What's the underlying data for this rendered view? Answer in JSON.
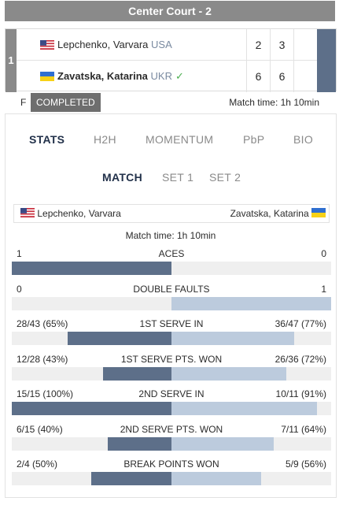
{
  "court_title": "Center Court - 2",
  "match": {
    "round": "1",
    "players": [
      {
        "name": "Lepchenko, Varvara",
        "country": "USA",
        "flag_icon": "us-flag-icon",
        "winner": false,
        "sets": [
          "2",
          "3",
          ""
        ]
      },
      {
        "name": "Zavatska, Katarina",
        "country": "UKR",
        "flag_icon": "ukraine-flag-icon",
        "winner": true,
        "winner_icon": "checkmark-icon",
        "sets": [
          "6",
          "6",
          ""
        ]
      }
    ],
    "status_prefix": "F",
    "status": "COMPLETED",
    "match_time": "Match time: 1h 10min"
  },
  "tabs": [
    {
      "label": "STATS",
      "active": true
    },
    {
      "label": "H2H",
      "active": false
    },
    {
      "label": "MOMENTUM",
      "active": false
    },
    {
      "label": "PbP",
      "active": false
    },
    {
      "label": "BIO",
      "active": false
    }
  ],
  "subtabs": [
    {
      "label": "MATCH",
      "active": true
    },
    {
      "label": "SET 1",
      "active": false
    },
    {
      "label": "SET 2",
      "active": false
    }
  ],
  "stats_players": {
    "left": "Lepchenko, Varvara",
    "right": "Zavatska, Katarina"
  },
  "stats_match_time": "Match time: 1h 10min",
  "stats": [
    {
      "name": "ACES",
      "left": "1",
      "right": "0",
      "left_frac": 1.0,
      "right_frac": 0.0
    },
    {
      "name": "DOUBLE FAULTS",
      "left": "0",
      "right": "1",
      "left_frac": 0.0,
      "right_frac": 1.0
    },
    {
      "name": "1ST SERVE IN",
      "left": "28/43 (65%)",
      "right": "36/47 (77%)",
      "left_frac": 0.65,
      "right_frac": 0.77
    },
    {
      "name": "1ST SERVE PTS. WON",
      "left": "12/28 (43%)",
      "right": "26/36 (72%)",
      "left_frac": 0.43,
      "right_frac": 0.72
    },
    {
      "name": "2ND SERVE IN",
      "left": "15/15 (100%)",
      "right": "10/11 (91%)",
      "left_frac": 1.0,
      "right_frac": 0.91
    },
    {
      "name": "2ND SERVE PTS. WON",
      "left": "6/15 (40%)",
      "right": "7/11 (64%)",
      "left_frac": 0.4,
      "right_frac": 0.64
    },
    {
      "name": "BREAK POINTS WON",
      "left": "2/4 (50%)",
      "right": "5/9 (56%)",
      "left_frac": 0.5,
      "right_frac": 0.56
    }
  ],
  "colors": {
    "left_bar": "#5d6f89",
    "right_bar": "#bccbdd",
    "header_bg": "#8a8a8a",
    "winner_check": "#4caf50"
  }
}
